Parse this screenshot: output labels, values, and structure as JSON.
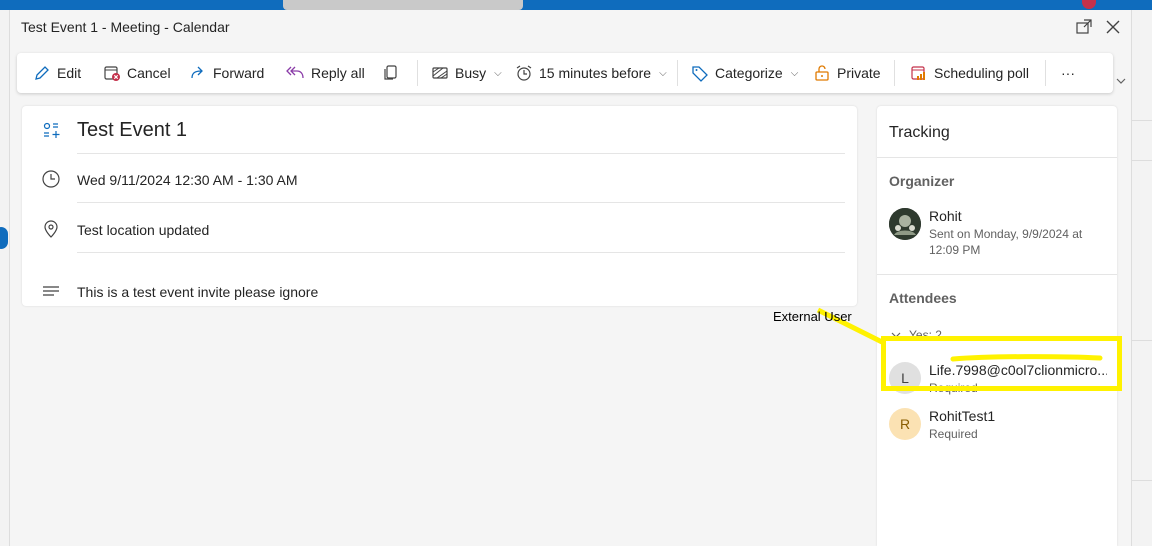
{
  "window": {
    "title": "Test Event 1 - Meeting - Calendar"
  },
  "toolbar": {
    "edit": "Edit",
    "cancel": "Cancel",
    "forward": "Forward",
    "reply_all": "Reply all",
    "busy": "Busy",
    "reminder": "15 minutes before",
    "categorize": "Categorize",
    "private": "Private",
    "scheduling_poll": "Scheduling poll",
    "more": "···"
  },
  "event": {
    "title": "Test Event 1",
    "datetime": "Wed 9/11/2024 12:30 AM - 1:30 AM",
    "location": "Test location updated",
    "body": "This is a test event invite please ignore"
  },
  "tracking": {
    "heading": "Tracking",
    "organizer_heading": "Organizer",
    "organizer": {
      "name": "Rohit",
      "sent": "Sent on Monday, 9/9/2024 at 12:09 PM"
    },
    "attendees_heading": "Attendees",
    "yes_label": "Yes: 2",
    "attendees": [
      {
        "initial": "L",
        "name": "Life.7998@c0ol7clionmicro...",
        "role": "Required",
        "avatar_bg": "#e0e0e0",
        "avatar_fg": "#424242"
      },
      {
        "initial": "R",
        "name": "RohitTest1",
        "role": "Required",
        "avatar_bg": "#fbe2b3",
        "avatar_fg": "#8a5d00"
      }
    ]
  },
  "annotation": {
    "label": "External User",
    "color": "#fff200"
  },
  "colors": {
    "accent": "#0f6cbd",
    "cancel_red": "#c4314b",
    "private_orange": "#e07a00"
  }
}
